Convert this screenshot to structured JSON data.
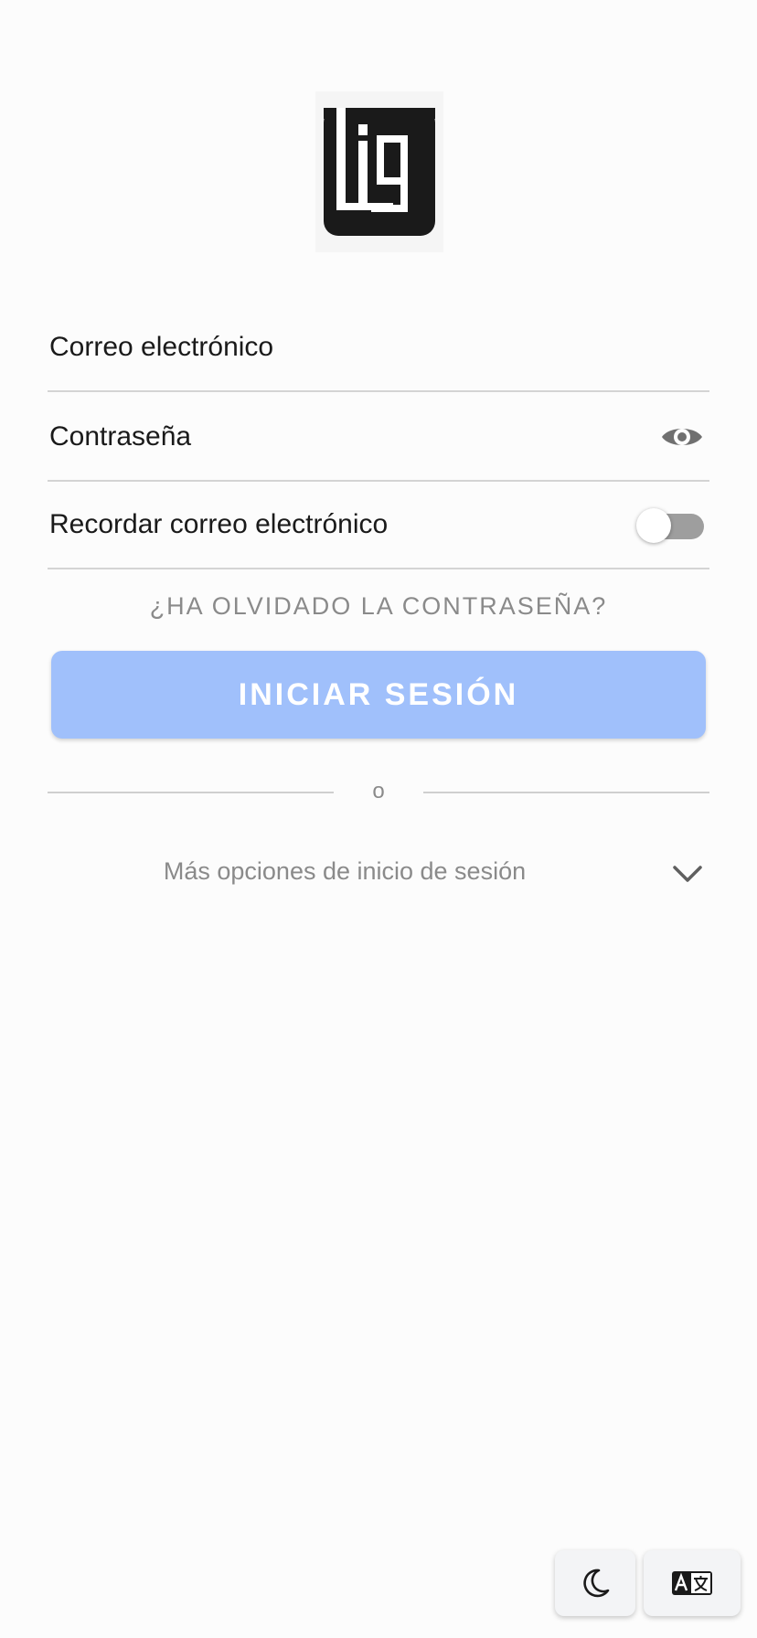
{
  "logo": {
    "text": "Lig",
    "color": "#1a1a1a"
  },
  "form": {
    "email": {
      "placeholder": "Correo electrónico",
      "value": ""
    },
    "password": {
      "placeholder": "Contraseña",
      "value": "",
      "toggle_icon": "eye-icon"
    },
    "remember": {
      "label": "Recordar correo electrónico",
      "checked": false
    }
  },
  "forgot_password": "¿HA OLVIDADO LA CONTRASEÑA?",
  "signin_button": "INICIAR SESIÓN",
  "divider_text": "o",
  "more_options": {
    "label": "Más opciones de inicio de sesión",
    "icon": "chevron-down-icon"
  },
  "floating_buttons": [
    {
      "icon": "moon-icon"
    },
    {
      "icon": "translate-icon"
    }
  ],
  "colors": {
    "accent_disabled": "#a0c0fb",
    "muted_text": "#8a8a8a",
    "divider": "#d4d4d4",
    "toggle_off": "#9e9e9e"
  }
}
